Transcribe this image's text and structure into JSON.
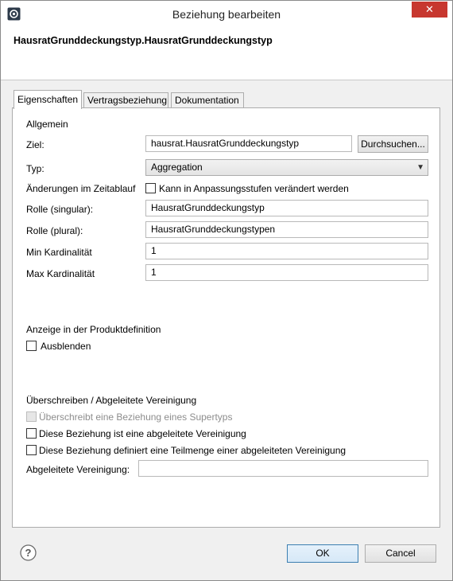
{
  "window": {
    "title": "Beziehung bearbeiten",
    "close_label": "✕"
  },
  "header": {
    "title": "HausratGrunddeckungstyp.HausratGrunddeckungstyp"
  },
  "tabs": [
    {
      "label": "Eigenschaften",
      "active": true
    },
    {
      "label": "Vertragsbeziehung",
      "active": false
    },
    {
      "label": "Dokumentation",
      "active": false
    }
  ],
  "general": {
    "section_label": "Allgemein",
    "target_label": "Ziel:",
    "target_value": "hausrat.HausratGrunddeckungstyp",
    "browse_label": "Durchsuchen...",
    "type_label": "Typ:",
    "type_value": "Aggregation",
    "changes_label": "Änderungen im Zeitablauf",
    "changes_checkbox_label": "Kann in Anpassungsstufen verändert werden",
    "role_singular_label": "Rolle (singular):",
    "role_singular_value": "HausratGrunddeckungstyp",
    "role_plural_label": "Rolle (plural):",
    "role_plural_value": "HausratGrunddeckungstypen",
    "min_card_label": "Min Kardinalität",
    "min_card_value": "1",
    "max_card_label": "Max Kardinalität",
    "max_card_value": "1"
  },
  "product_display": {
    "section_label": "Anzeige in der Produktdefinition",
    "hide_label": "Ausblenden"
  },
  "override": {
    "section_label": "Überschreiben / Abgeleitete Vereinigung",
    "overrides_supertype_label": "Überschreibt eine Beziehung eines Supertyps",
    "derived_union_label": "Diese Beziehung ist eine abgeleitete Vereinigung",
    "subset_label": "Diese Beziehung definiert eine Teilmenge einer abgeleiteten Vereinigung",
    "derived_union_field_label": "Abgeleitete Vereinigung:",
    "derived_union_field_value": ""
  },
  "footer": {
    "help_label": "?",
    "ok_label": "OK",
    "cancel_label": "Cancel"
  },
  "colors": {
    "close_button": "#c7372f",
    "ok_border": "#3c7fb1"
  },
  "icons": {
    "app": "eclipse-app-icon",
    "help": "help-icon",
    "dropdown": "chevron-down-icon"
  }
}
